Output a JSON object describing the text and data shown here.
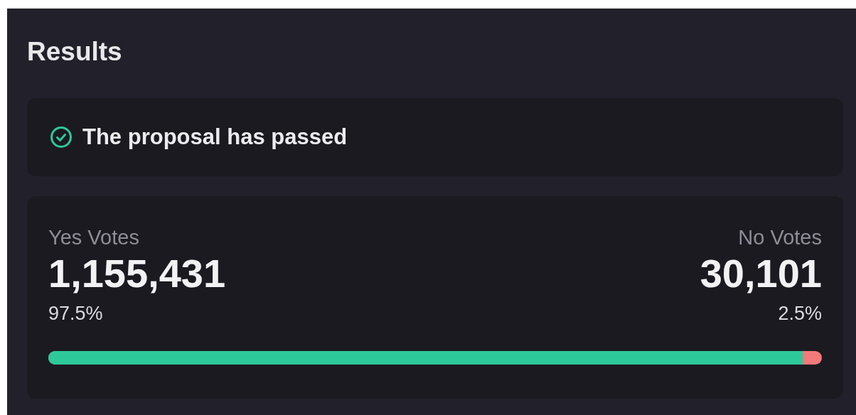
{
  "title": "Results",
  "status": {
    "text": "The proposal has passed",
    "passed": true
  },
  "votes": {
    "yes": {
      "label": "Yes Votes",
      "count": "1,155,431",
      "percent": "97.5%"
    },
    "no": {
      "label": "No Votes",
      "count": "30,101",
      "percent": "2.5%"
    },
    "level": 0.975
  }
}
